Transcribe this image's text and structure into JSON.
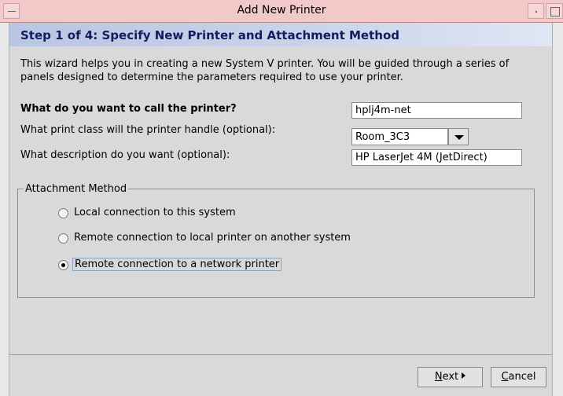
{
  "window": {
    "title": "Add New Printer"
  },
  "step": {
    "title": "Step 1 of 4: Specify New Printer and Attachment Method"
  },
  "intro": {
    "text": "This wizard helps you in creating a new System V printer.  You will be guided through a series of panels designed to determine the parameters required to use your printer."
  },
  "form": {
    "name_label": "What do you want to call the printer?",
    "name_value": "hplj4m-net",
    "class_label": "What print class will the printer handle (optional):",
    "class_value": "Room_3C3",
    "description_label": "What description do you want (optional):",
    "description_value": "HP LaserJet 4M (JetDirect)"
  },
  "attachment": {
    "legend": "Attachment Method",
    "options": [
      {
        "label": "Local connection to this system",
        "checked": false
      },
      {
        "label": "Remote connection to local printer on another system",
        "checked": false
      },
      {
        "label": "Remote connection to a network printer",
        "checked": true
      }
    ]
  },
  "buttons": {
    "next_mnemonic": "N",
    "next_rest": "ext",
    "cancel_mnemonic": "C",
    "cancel_rest": "ancel"
  },
  "icons": [
    "window-menu-icon",
    "minimize-icon",
    "maximize-icon",
    "chevron-down-icon",
    "next-arrow-icon"
  ]
}
